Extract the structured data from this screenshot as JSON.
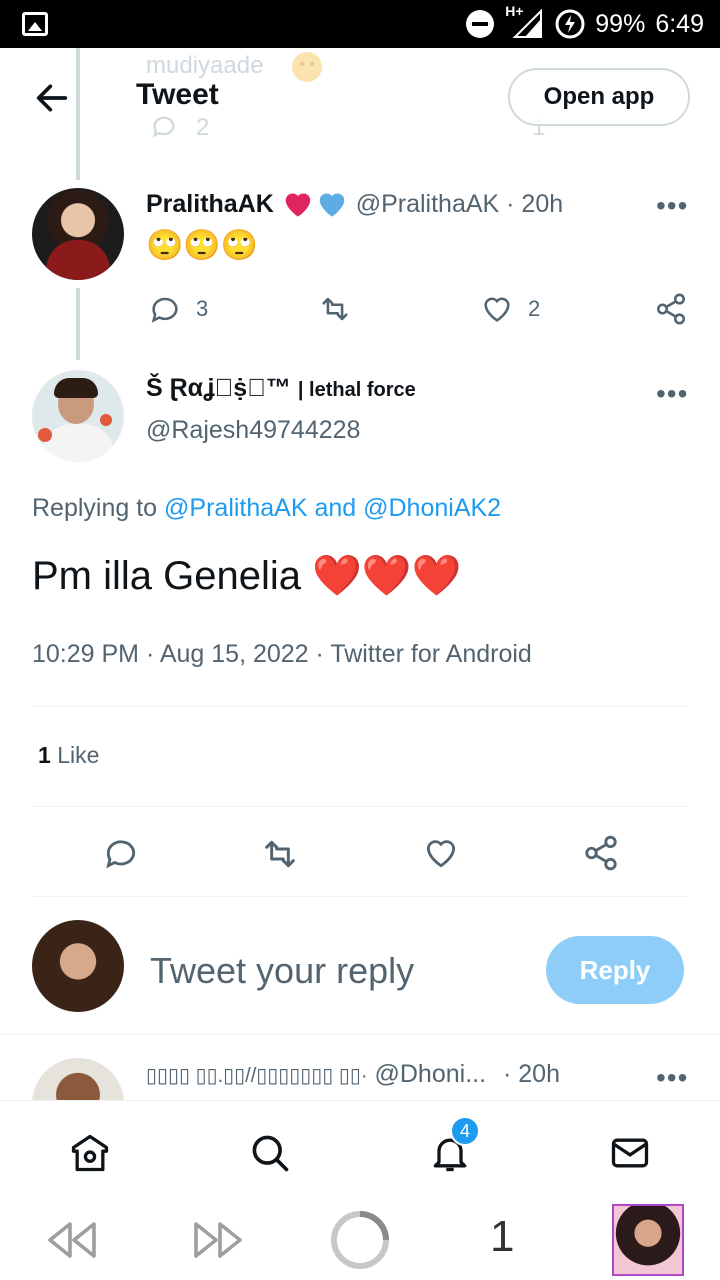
{
  "status_bar": {
    "network": "H+",
    "battery": "99%",
    "time": "6:49"
  },
  "header": {
    "title": "Tweet",
    "open_app_label": "Open app",
    "ghost_text": "mudiyaade",
    "ghost_reply_count": "2",
    "ghost_like_count": "1"
  },
  "tweet1": {
    "name": "PralithaAK",
    "handle_time": "@PralithaAK · 20h",
    "body": "🙄🙄🙄",
    "reply_count": "3",
    "like_count": "2"
  },
  "main_tweet": {
    "name": "Š Ɽαʝ⃟ṩ⃟™",
    "bio": "| lethal force",
    "handle": "@Rajesh49744228",
    "replying_prefix": "Replying to",
    "replying_to": "@PralithaAK and @DhoniAK2",
    "body": "Pm illa Genelia ❤️❤️❤️",
    "timestamp": "10:29 PM · Aug 15, 2022 · Twitter for Android",
    "like_count": "1",
    "like_label": "Like"
  },
  "compose": {
    "placeholder": "Tweet your reply",
    "reply_label": "Reply"
  },
  "next_tweet": {
    "name": "▯▯▯▯ ▯▯.▯▯//▯▯▯▯▯▯▯ ▯▯·",
    "handle": "@Dhoni...",
    "time": "· 20h"
  },
  "nav": {
    "notification_badge": "4"
  },
  "browser": {
    "tab_count": "1"
  },
  "colors": {
    "accent": "#1d9bf0",
    "heart_red": "#e0245e",
    "heart_blue": "#5dade2",
    "muted": "#536471"
  }
}
